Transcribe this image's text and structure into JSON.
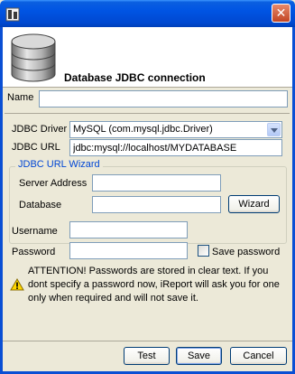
{
  "window": {
    "close_glyph": "✕"
  },
  "header": {
    "title": "Database JDBC connection"
  },
  "form": {
    "name_label": "Name",
    "name_value": "",
    "driver_label": "JDBC Driver",
    "driver_value": "MySQL (com.mysql.jdbc.Driver)",
    "url_label": "JDBC URL",
    "url_value": "jdbc:mysql://localhost/MYDATABASE",
    "wizard_title": "JDBC URL Wizard",
    "server_label": "Server Address",
    "server_value": "",
    "database_label": "Database",
    "database_value": "",
    "wizard_button": "Wizard",
    "username_label": "Username",
    "username_value": "",
    "password_label": "Password",
    "password_value": "",
    "save_password_label": "Save password",
    "save_password_checked": false,
    "attention_text": "ATTENTION! Passwords are stored in clear text. If you dont specify a password now, iReport will ask you for one only when required and will not save it."
  },
  "buttons": {
    "test": "Test",
    "save": "Save",
    "cancel": "Cancel"
  },
  "icons": {
    "app": "ireport-app-icon",
    "database": "database-icon",
    "warning": "warning-icon",
    "dropdown": "chevron-down-icon"
  },
  "colors": {
    "titlebar": "#0054e3",
    "dialog_bg": "#ece9d8",
    "legend_blue": "#0046d5"
  }
}
